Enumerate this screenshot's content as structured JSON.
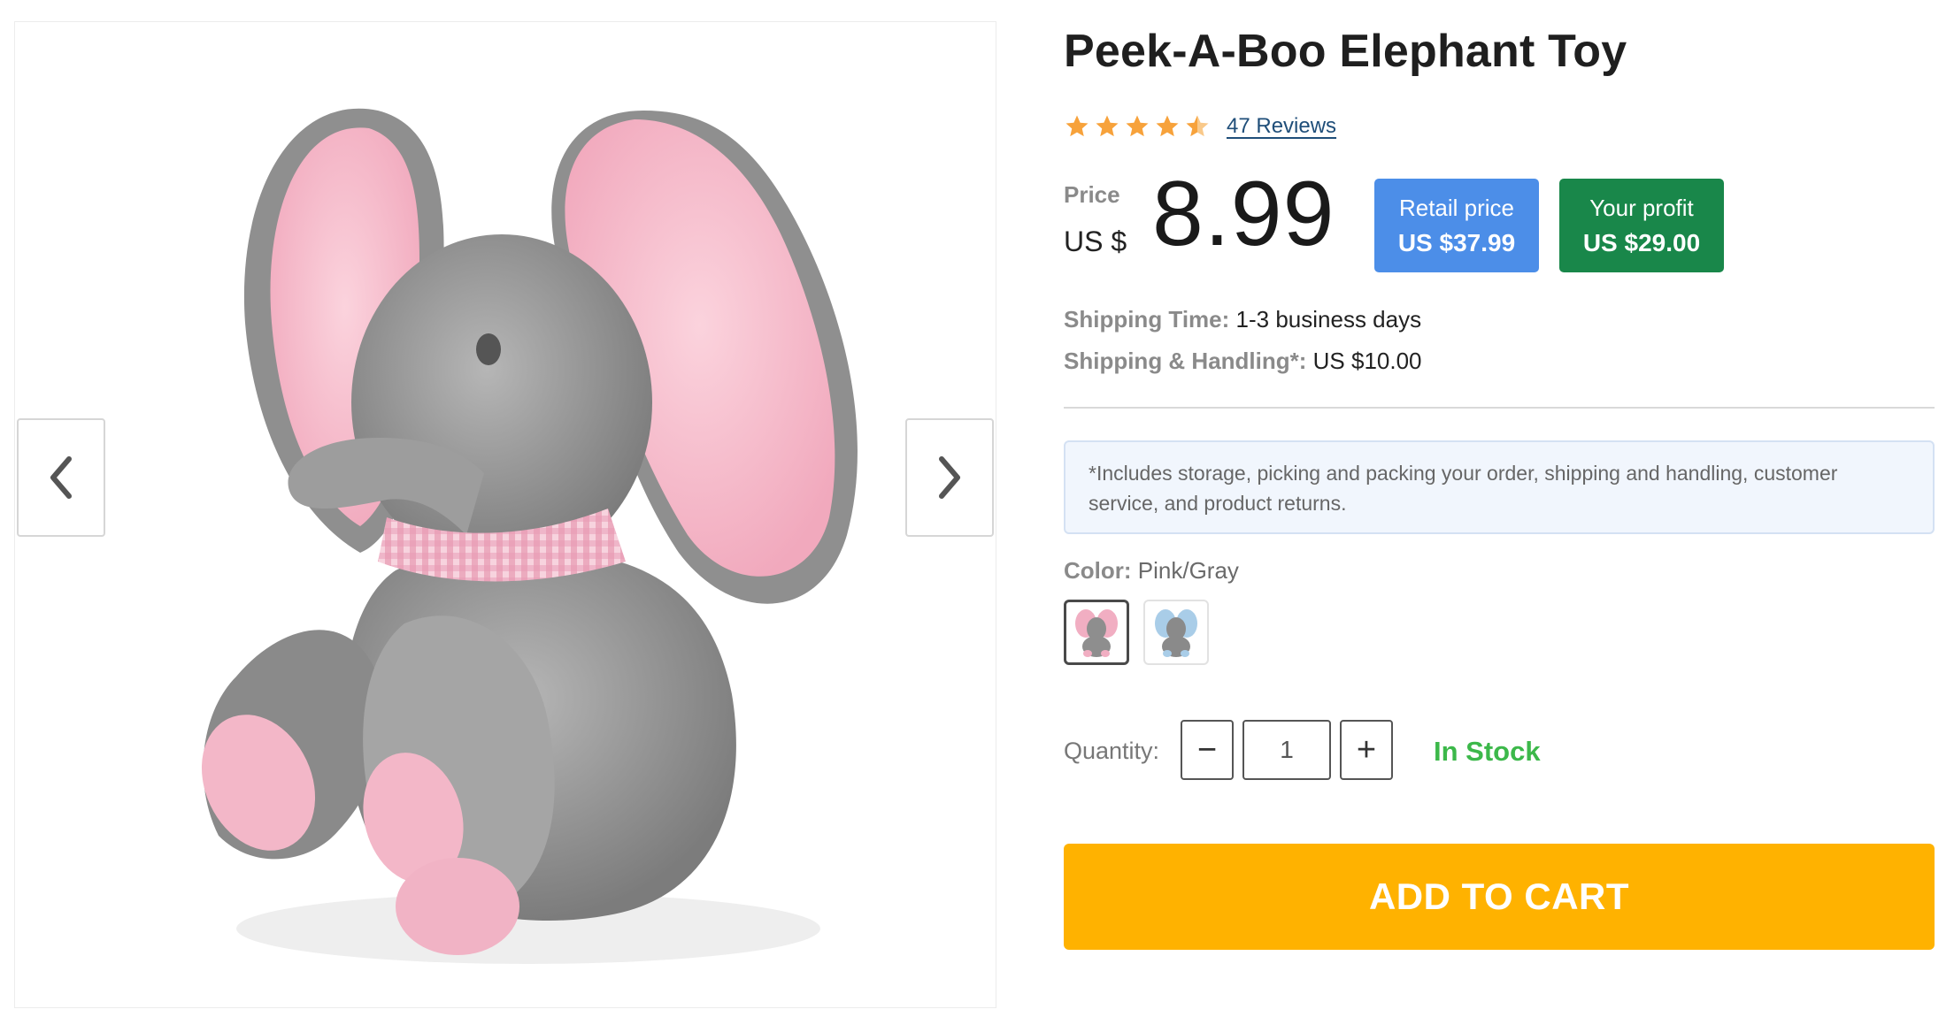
{
  "product": {
    "title": "Peek-A-Boo Elephant Toy",
    "rating": 4.5,
    "reviews_text": "47 Reviews"
  },
  "price": {
    "label": "Price",
    "currency": "US $",
    "value": "8.99"
  },
  "retail": {
    "label": "Retail price",
    "value": "US $37.99"
  },
  "profit": {
    "label": "Your profit",
    "value": "US $29.00"
  },
  "shipping": {
    "time_label": "Shipping Time:",
    "time_value": "1-3 business days",
    "handling_label": "Shipping & Handling*:",
    "handling_value": "US $10.00"
  },
  "note": "*Includes storage, picking and packing your order, shipping and handling, customer service, and product returns.",
  "color": {
    "label": "Color:",
    "selected": "Pink/Gray",
    "swatches": [
      "pink-gray-elephant",
      "blue-gray-elephant"
    ]
  },
  "quantity": {
    "label": "Quantity:",
    "minus": "−",
    "plus": "+",
    "value": "1"
  },
  "stock": "In Stock",
  "cart": {
    "label": "ADD TO CART"
  },
  "colors": {
    "star": "#f7a23b",
    "retail_badge": "#4c8ee8",
    "profit_badge": "#19874a",
    "in_stock": "#3cb84a",
    "cart_button": "#ffb200"
  },
  "icons": {
    "prev": "chevron-left-icon",
    "next": "chevron-right-icon",
    "star": "star-icon"
  }
}
